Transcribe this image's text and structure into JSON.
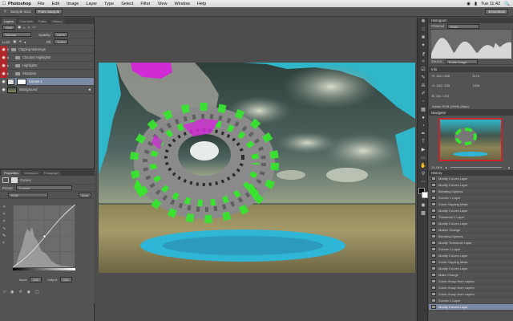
{
  "menubar": {
    "apple": "",
    "app": "Photoshop",
    "items": [
      "File",
      "Edit",
      "Image",
      "Layer",
      "Type",
      "Select",
      "Filter",
      "View",
      "Window",
      "Help"
    ],
    "clock": "Tue 11:42",
    "spotlight": "🔍"
  },
  "options": {
    "tool_label": "Sample Size:",
    "tool_value": "Point Sample",
    "sample_value": "Sample Size:",
    "layers_value": "Point Sample",
    "workspace": "Essentials"
  },
  "layers_panel": {
    "tabs": [
      "Layers",
      "Channels",
      "Paths",
      "History"
    ],
    "kind_label": "Kind",
    "blend": "Normal",
    "opacity_label": "Opacity:",
    "opacity": "100%",
    "lock_label": "Lock:",
    "fill_label": "Fill:",
    "fill": "100%",
    "layers": [
      {
        "name": "Clipping Warnings",
        "kind": "folder",
        "eye": "red",
        "indent": 0
      },
      {
        "name": "Clouded Highlights",
        "kind": "folder",
        "eye": "red",
        "indent": 1
      },
      {
        "name": "Highlights",
        "kind": "folder",
        "eye": "red",
        "indent": 1
      },
      {
        "name": "Shadows",
        "kind": "folder",
        "eye": "red",
        "indent": 1
      },
      {
        "name": "Curves 1",
        "kind": "adjust",
        "eye": "plain",
        "indent": 0,
        "active": true
      },
      {
        "name": "Background",
        "kind": "image",
        "eye": "plain",
        "indent": 0
      }
    ]
  },
  "properties": {
    "tabs": [
      "Properties",
      "Character",
      "Paragraph"
    ],
    "title": "Curves",
    "preset_label": "Preset:",
    "preset": "Custom",
    "channel": "RGB",
    "auto": "Auto",
    "input_label": "Input:",
    "input_value": "105",
    "output_label": "Output:",
    "output_value": "124"
  },
  "histogram": {
    "title": "Histogram",
    "channel_label": "Channel:",
    "channel": "RGB",
    "source_label": "Source:",
    "source": "Entire Image"
  },
  "info": {
    "title": "Info",
    "r_label": "R:",
    "g_label": "G:",
    "b_label": "B:",
    "values": [
      "163 / 255",
      "153 / 235",
      "151 / 221",
      "1174",
      "1026"
    ],
    "profile": "Adobe RGB (1998) (8bpc)"
  },
  "navigator": {
    "title": "Navigator",
    "zoom": "24.18%"
  },
  "history": {
    "title": "History",
    "items": [
      "Modify Curves Layer",
      "Modify Curves Layer",
      "Blending Options",
      "Curves 1 Layer",
      "Circle Clipping Mask",
      "Modify Curves Layer",
      "Threshold 1 Layer",
      "Modify Curves Layer",
      "Master Change",
      "Blending Options",
      "Modify Threshold Layer",
      "Curves 1 Layer",
      "Modify Curves Layer",
      "Circle Clipping Mask",
      "Modify Curves Layer",
      "Make Change",
      "Circle Group from Layers",
      "Circle Group from Layers",
      "Circle Group from Layers",
      "Curves 1 Layer",
      "Modify Curves Layer"
    ]
  },
  "colors": {
    "sky": "#2fb6c9",
    "magenta": "#d02bd4",
    "green": "#38e42e",
    "pool": "#2fb6d6"
  }
}
